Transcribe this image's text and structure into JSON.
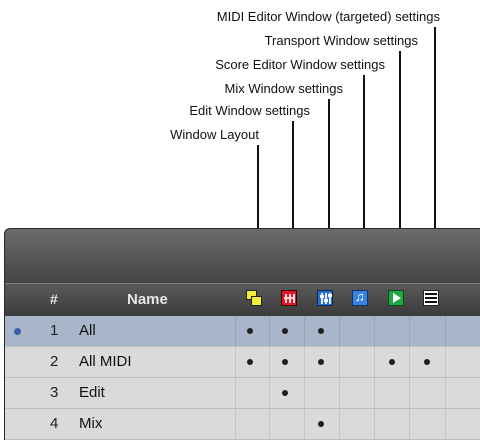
{
  "callouts": [
    {
      "id": "midi",
      "text": "MIDI Editor Window (targeted) settings"
    },
    {
      "id": "transport",
      "text": "Transport Window settings"
    },
    {
      "id": "score",
      "text": "Score Editor Window settings"
    },
    {
      "id": "mix",
      "text": "Mix Window settings"
    },
    {
      "id": "edit",
      "text": "Edit Window settings"
    },
    {
      "id": "layout",
      "text": "Window Layout"
    }
  ],
  "header": {
    "num_label": "#",
    "name_label": "Name",
    "icons": [
      "window-layout-icon",
      "edit-window-icon",
      "mix-window-icon",
      "score-editor-icon",
      "transport-window-icon",
      "midi-editor-icon"
    ]
  },
  "rows": [
    {
      "num": "1",
      "name": "All",
      "selected": true,
      "flags": [
        true,
        true,
        true,
        false,
        false,
        false
      ]
    },
    {
      "num": "2",
      "name": "All MIDI",
      "selected": false,
      "flags": [
        true,
        true,
        true,
        false,
        true,
        true
      ]
    },
    {
      "num": "3",
      "name": "Edit",
      "selected": false,
      "flags": [
        false,
        true,
        false,
        false,
        false,
        false
      ]
    },
    {
      "num": "4",
      "name": "Mix",
      "selected": false,
      "flags": [
        false,
        false,
        true,
        false,
        false,
        false
      ]
    }
  ],
  "colors": {
    "selected_row": "#a9b5c8",
    "row": "#dadada",
    "header": "#444444",
    "layout_icon": "#f4ec3a",
    "edit_icon": "#e0162b",
    "mix_icon": "#2a6fd0",
    "score_icon": "#3a82e0",
    "transport_icon": "#1da843"
  }
}
